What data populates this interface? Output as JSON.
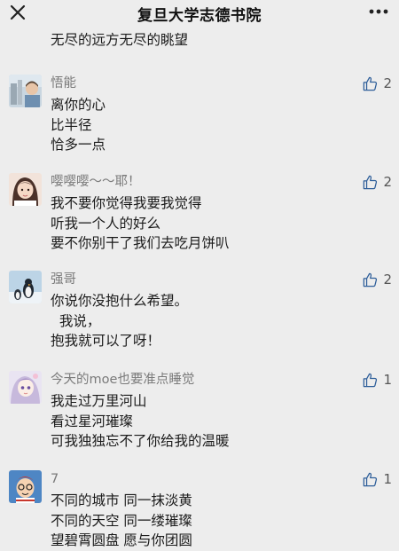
{
  "header": {
    "title": "复旦大学志德书院",
    "close_icon": "close-icon",
    "more_icon": "more-dots-icon"
  },
  "previous_comment_tail": "无尽的远方无尽的眺望",
  "comments": [
    {
      "nickname": "悟能",
      "likes": "2",
      "lines": [
        "离你的心",
        "比半径",
        "恰多一点"
      ]
    },
    {
      "nickname": "嘤嘤嘤～～耶！",
      "likes": "2",
      "lines": [
        "我不要你觉得我要我觉得",
        "听我一个人的好么",
        "要不你别干了我们去吃月饼叭"
      ]
    },
    {
      "nickname": "强哥",
      "likes": "2",
      "lines": [
        "你说你没抱什么希望。",
        "  我说，",
        "抱我就可以了呀！"
      ]
    },
    {
      "nickname": "今天的moe也要准点睡觉",
      "likes": "1",
      "lines": [
        "我走过万里河山",
        "看过星河璀璨",
        "可我独独忘不了你给我的温暖"
      ]
    },
    {
      "nickname": "7",
      "likes": "1",
      "lines": [
        "不同的城市 同一抹淡黄",
        "不同的天空 同一缕璀璨",
        "望碧霄圆盘 愿与你团圆"
      ]
    }
  ],
  "colors": {
    "background": "#ededed",
    "nickname": "#7a7a7a",
    "text": "#1a1a1a"
  },
  "like_icon": "thumbs-up-icon"
}
